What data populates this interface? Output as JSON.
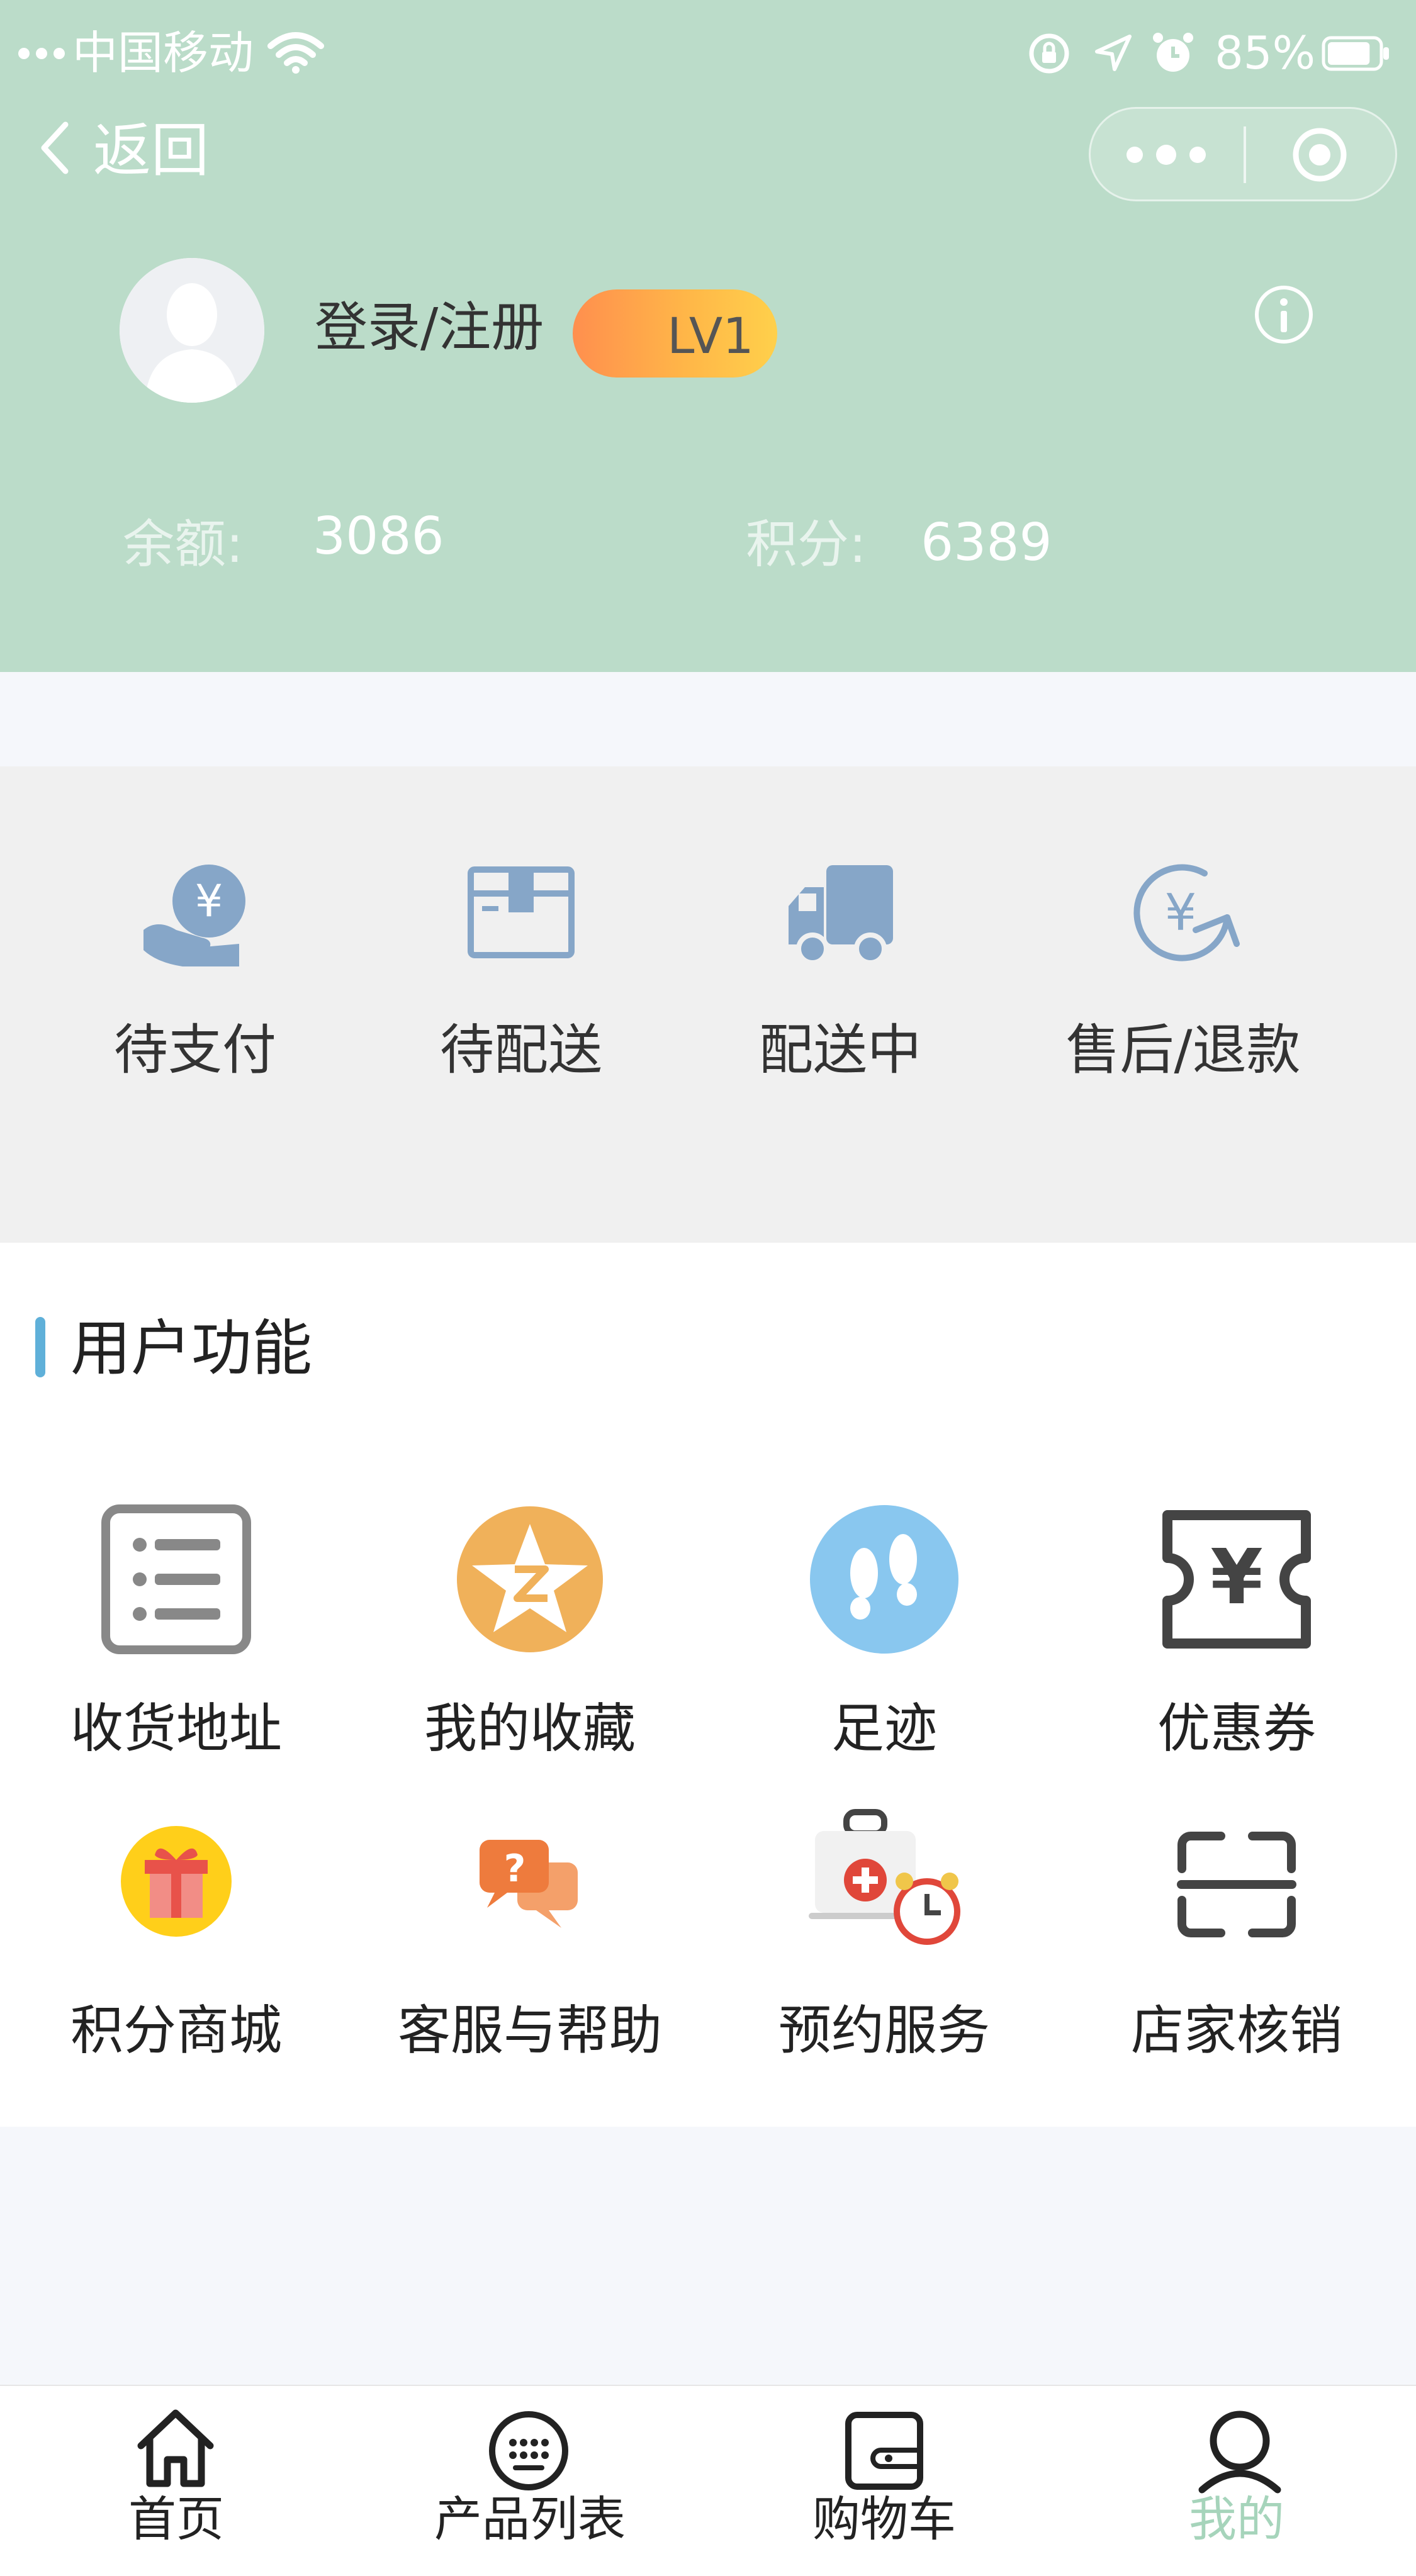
{
  "status_bar": {
    "carrier": "中国移动",
    "battery": "85%",
    "battery_level": 0.85
  },
  "nav": {
    "back_label": "返回",
    "more_icon": "more-dots-icon",
    "close_icon": "record-circle-icon"
  },
  "profile": {
    "avatar_icon": "default-avatar-icon",
    "login_label": "登录/注册",
    "level_badge": "LV1",
    "info_icon": "info-icon",
    "balance_label": "余额:",
    "balance_value": "3086",
    "points_label": "积分:",
    "points_value": "6389"
  },
  "orders": [
    {
      "label": "待支付",
      "icon": "yen-hand-icon"
    },
    {
      "label": "待配送",
      "icon": "package-box-icon"
    },
    {
      "label": "配送中",
      "icon": "delivery-truck-icon"
    },
    {
      "label": "售后/退款",
      "icon": "yen-refund-icon"
    }
  ],
  "user_functions": {
    "title": "用户功能",
    "items": [
      {
        "label": "收货地址",
        "icon": "address-list-icon"
      },
      {
        "label": "我的收藏",
        "icon": "favorite-star-icon"
      },
      {
        "label": "足迹",
        "icon": "footprints-icon"
      },
      {
        "label": "优惠券",
        "icon": "coupon-icon"
      },
      {
        "label": "积分商城",
        "icon": "gift-icon"
      },
      {
        "label": "客服与帮助",
        "icon": "help-chat-icon"
      },
      {
        "label": "预约服务",
        "icon": "appointment-alarm-icon"
      },
      {
        "label": "店家核销",
        "icon": "scan-icon"
      }
    ]
  },
  "tabbar": {
    "active": "我的",
    "items": [
      {
        "label": "首页",
        "icon": "home-icon"
      },
      {
        "label": "产品列表",
        "icon": "product-list-icon"
      },
      {
        "label": "购物车",
        "icon": "cart-wallet-icon"
      },
      {
        "label": "我的",
        "icon": "profile-icon"
      }
    ]
  },
  "colors": {
    "header_bg": "#bbdcc9",
    "active_tab": "#a6d4bb",
    "icon_blue": "#86a6c8",
    "section_accent": "#5fb0d9"
  }
}
